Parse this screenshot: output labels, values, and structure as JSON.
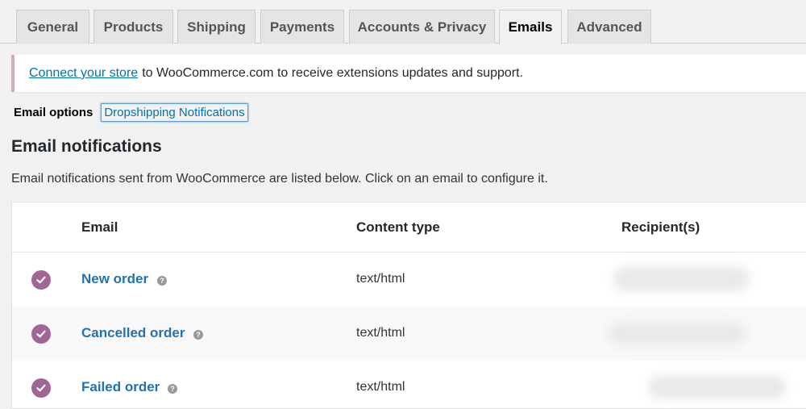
{
  "tabs": [
    "General",
    "Products",
    "Shipping",
    "Payments",
    "Accounts & Privacy",
    "Emails",
    "Advanced"
  ],
  "active_tab": "Emails",
  "notice": {
    "link": "Connect your store",
    "text": "to WooCommerce.com to receive extensions updates and support."
  },
  "subnav": {
    "current": "Email options",
    "link": "Dropshipping Notifications"
  },
  "section": {
    "title": "Email notifications",
    "description": "Email notifications sent from WooCommerce are listed below. Click on an email to configure it."
  },
  "table": {
    "headers": {
      "email": "Email",
      "content_type": "Content type",
      "recipients": "Recipient(s)"
    },
    "rows": [
      {
        "name": "New order",
        "content_type": "text/html"
      },
      {
        "name": "Cancelled order",
        "content_type": "text/html"
      },
      {
        "name": "Failed order",
        "content_type": "text/html"
      }
    ],
    "help_symbol": "?"
  },
  "colors": {
    "accent": "#a16696",
    "link": "#2271b1",
    "notice_border": "#d7a8c6"
  },
  "icons": {
    "enabled": "check-circle-icon",
    "help": "help-icon"
  }
}
